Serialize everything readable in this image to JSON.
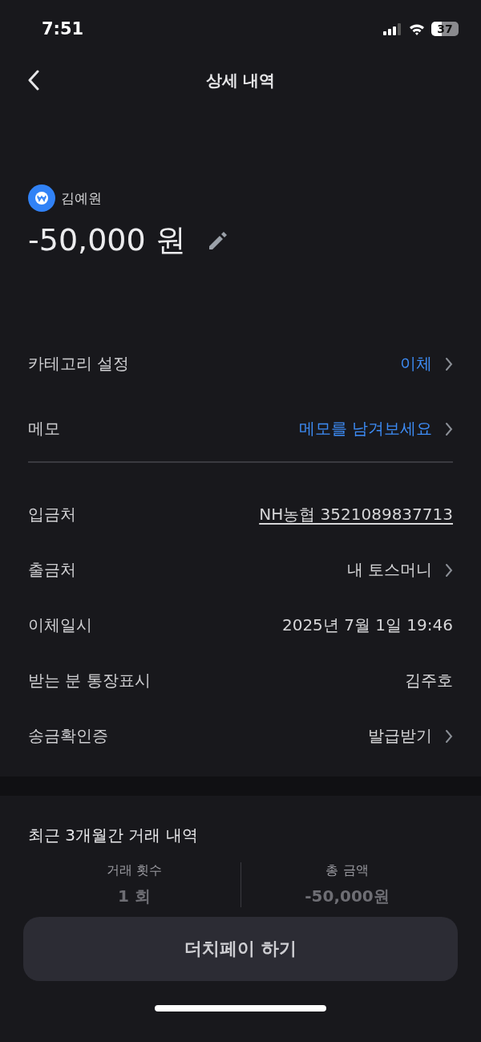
{
  "status_bar": {
    "time": "7:51",
    "battery": "37"
  },
  "header": {
    "title": "상세 내역"
  },
  "transaction": {
    "account_name": "김예원",
    "amount": "-50,000 원"
  },
  "settings_rows": [
    {
      "label": "카테고리 설정",
      "value": "이체",
      "kind": "action",
      "chevron": true
    },
    {
      "label": "메모",
      "value": "메모를 남겨보세요",
      "kind": "action",
      "chevron": true
    }
  ],
  "detail_rows": [
    {
      "label": "입금처",
      "value": "NH농협 3521089837713",
      "kind": "link",
      "chevron": false
    },
    {
      "label": "출금처",
      "value": "내 토스머니",
      "kind": "info",
      "chevron": true
    },
    {
      "label": "이체일시",
      "value": "2025년 7월 1일 19:46",
      "kind": "info",
      "chevron": false
    },
    {
      "label": "받는 분 통장표시",
      "value": "김주호",
      "kind": "info",
      "chevron": false
    },
    {
      "label": "송금확인증",
      "value": "발급받기",
      "kind": "info",
      "chevron": true
    }
  ],
  "history": {
    "title": "최근 3개월간 거래 내역",
    "stats": [
      {
        "label": "거래 횟수",
        "value": "1 회"
      },
      {
        "label": "총 금액",
        "value": "-50,000원"
      }
    ]
  },
  "primary_button": "더치페이 하기"
}
